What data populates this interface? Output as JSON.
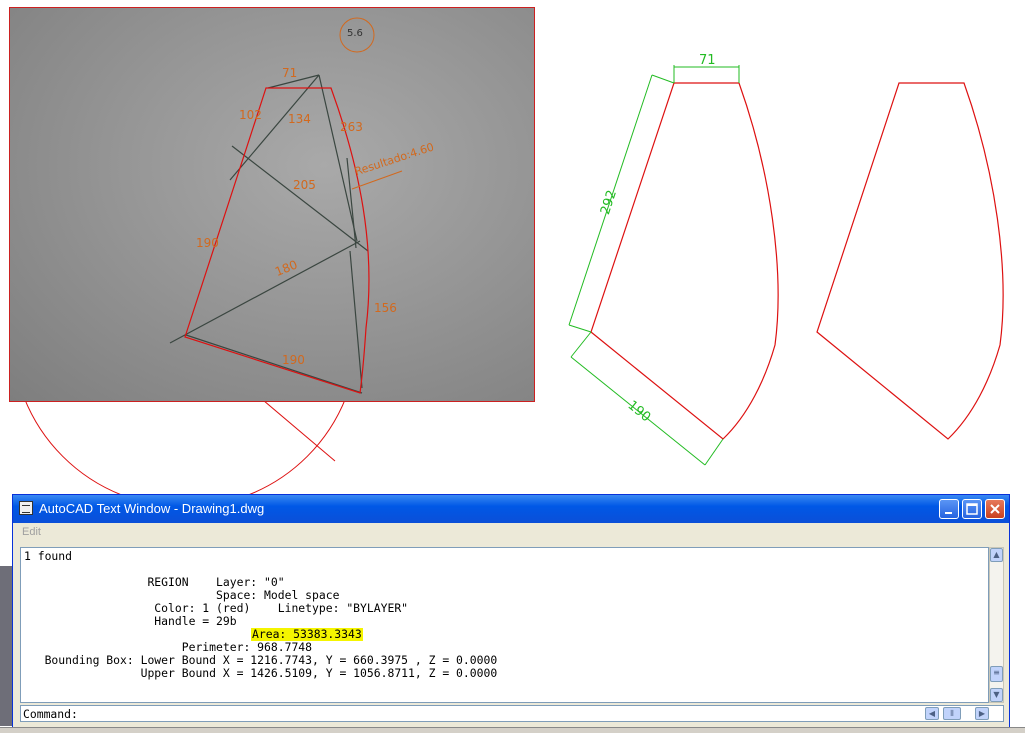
{
  "photo": {
    "circle_note": "5.6",
    "label_71": "71",
    "label_102": "102",
    "label_134": "134",
    "label_263": "263",
    "label_resultado": "Resultado:4.60",
    "label_205": "205",
    "label_190_left": "190",
    "label_180": "180",
    "label_156": "156",
    "label_190_bottom": "190"
  },
  "drawing": {
    "dim_top": "71",
    "dim_left": "292",
    "dim_bottom": "190",
    "colors": {
      "shape": "#dd1111",
      "dimension": "#22bb22",
      "sketch_line": "#3a4640"
    }
  },
  "text_window": {
    "title": "AutoCAD Text Window - Drawing1.dwg",
    "menu": {
      "edit": "Edit"
    },
    "output_lines": "1 found\n\n                  REGION    Layer: \"0\"\n                            Space: Model space\n                   Color: 1 (red)    Linetype: \"BYLAYER\"\n                   Handle = 29b\n\n                       Perimeter: 968.7748\n   Bounding Box: Lower Bound X = 1216.7743, Y = 660.3975 , Z = 0.0000\n                 Upper Bound X = 1426.5109, Y = 1056.8711, Z = 0.0000",
    "area_line": "Area: 53383.3343",
    "command_prompt": "Command:",
    "title_color": "#0058e6",
    "highlight_color": "#f5f500"
  }
}
